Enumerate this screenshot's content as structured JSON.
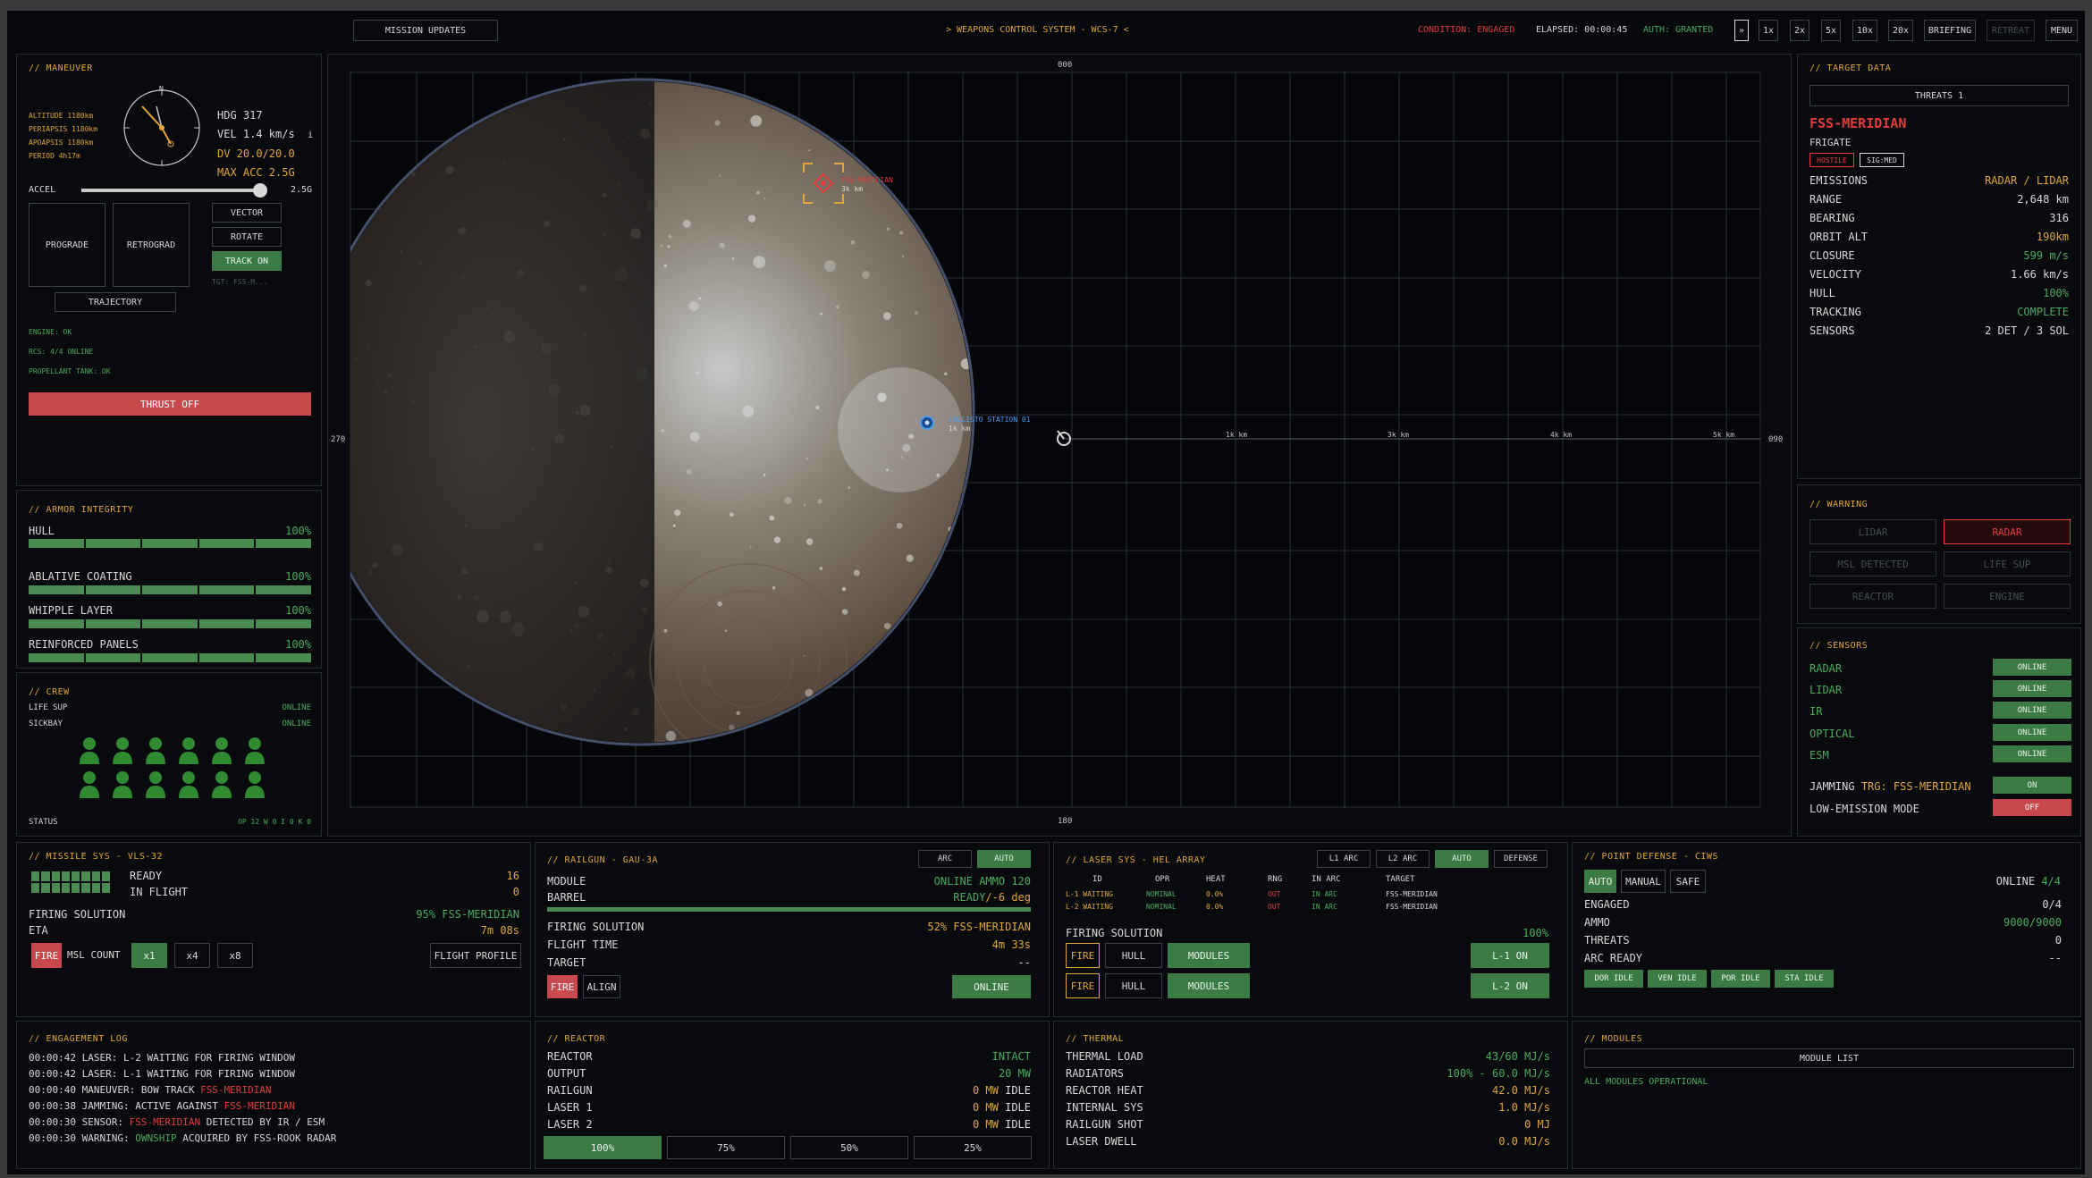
{
  "topbar": {
    "mission_updates": "MISSION UPDATES",
    "title": "> WEAPONS CONTROL SYSTEM - WCS-7 <",
    "condition_label": "CONDITION:",
    "condition_value": "ENGAGED",
    "elapsed": "ELAPSED: 00:00:45",
    "auth": "AUTH: GRANTED",
    "pause": "»",
    "speeds": [
      "1x",
      "2x",
      "5x",
      "10x",
      "20x"
    ],
    "briefing": "BRIEFING",
    "retreat": "RETREAT",
    "menu": "MENU"
  },
  "maneuver": {
    "title": "// MANEUVER",
    "orbit": [
      "ALTITUDE 1180km",
      "PERIAPSIS 1180km",
      "APOAPSIS 1180km",
      "PERIOD 4h17m"
    ],
    "compass_n": "N",
    "hdg": "HDG 317",
    "vel": "VEL 1.4 km/s",
    "vel_unit": "i",
    "dv": "DV 20.0/20.0",
    "max_acc": "MAX ACC 2.5G",
    "accel_label": "ACCEL",
    "accel_value": "2.5G",
    "accel_fraction": 1.0,
    "prograde": "PROGRADE",
    "retrograd": "RETROGRAD",
    "vector": "VECTOR",
    "rotate": "ROTATE",
    "track_on": "TRACK ON",
    "tgt": "TGT: FSS-M...",
    "trajectory": "TRAJECTORY",
    "status": [
      "ENGINE: OK",
      "RCS: 4/4 ONLINE",
      "PROPELLANT TANK: OK"
    ],
    "thrust_off": "THRUST OFF"
  },
  "armor": {
    "title": "// ARMOR INTEGRITY",
    "items": [
      {
        "label": "HULL",
        "value": "100%"
      },
      {
        "label": "ABLATIVE COATING",
        "value": "100%"
      },
      {
        "label": "WHIPPLE LAYER",
        "value": "100%"
      },
      {
        "label": "REINFORCED PANELS",
        "value": "100%"
      }
    ]
  },
  "crew": {
    "title": "// CREW",
    "life_sup_label": "LIFE SUP",
    "life_sup_value": "ONLINE",
    "sickbay_label": "SICKBAY",
    "sickbay_value": "ONLINE",
    "status_label": "STATUS",
    "status_value": "OP 12  W 0  I 0  K 0"
  },
  "map": {
    "top_label": "000",
    "left_label": "270",
    "right_label": "090",
    "bottom_label": "180",
    "ranges": [
      "1k km",
      "3k km",
      "4k km",
      "5k km"
    ],
    "target_name": "FSS MERIDIAN",
    "target_range": "3k km",
    "station_name": "CALLISTO STATION 01",
    "station_range": "1k km"
  },
  "target": {
    "title": "// TARGET DATA",
    "threats": "THREATS 1",
    "name": "FSS-MERIDIAN",
    "class": "FRIGATE",
    "tag_hostile": "HOSTILE",
    "tag_sig": "SIG:MED",
    "rows": [
      {
        "label": "EMISSIONS",
        "value": "RADAR / LIDAR"
      },
      {
        "label": "RANGE",
        "value": "2,648 km"
      },
      {
        "label": "BEARING",
        "value": "316"
      },
      {
        "label": "ORBIT ALT",
        "value": "190km"
      },
      {
        "label": "CLOSURE",
        "value": "599 m/s"
      },
      {
        "label": "VELOCITY",
        "value": "1.66 km/s"
      },
      {
        "label": "HULL",
        "value": "100%"
      },
      {
        "label": "TRACKING",
        "value": "COMPLETE"
      },
      {
        "label": "SENSORS",
        "value": "2 DET / 3 SOL"
      }
    ]
  },
  "warning": {
    "title": "// WARNING",
    "items": [
      "LIDAR",
      "RADAR",
      "MSL DETECTED",
      "LIFE SUP",
      "REACTOR",
      "ENGINE"
    ]
  },
  "sensors": {
    "title": "// SENSORS",
    "items": [
      {
        "label": "RADAR",
        "value": "ONLINE"
      },
      {
        "label": "LIDAR",
        "value": "ONLINE"
      },
      {
        "label": "IR",
        "value": "ONLINE"
      },
      {
        "label": "OPTICAL",
        "value": "ONLINE"
      },
      {
        "label": "ESM",
        "value": "ONLINE"
      }
    ],
    "jamming_label": "JAMMING",
    "jamming_target": "TRG: FSS-MERIDIAN",
    "jamming_value": "ON",
    "lowem_label": "LOW-EMISSION MODE",
    "lowem_value": "OFF"
  },
  "missile": {
    "title": "// MISSILE SYS - VLS-32",
    "ready_label": "READY",
    "ready_value": "16",
    "inflight_label": "IN FLIGHT",
    "inflight_value": "0",
    "fs_label": "FIRING SOLUTION",
    "fs_value": "95% FSS-MERIDIAN",
    "eta_label": "ETA",
    "eta_value": "7m 08s",
    "fire": "FIRE",
    "msl_count": "MSL COUNT",
    "counts": [
      "x1",
      "x4",
      "x8"
    ],
    "flight_profile": "FLIGHT PROFILE"
  },
  "railgun": {
    "title": "// RAILGUN - GAU-3A",
    "arc": "ARC",
    "auto": "AUTO",
    "module_label": "MODULE",
    "module_value": "ONLINE AMMO 120",
    "barrel_label": "BARREL",
    "barrel_ready": "READY",
    "barrel_deg": "/-6 deg",
    "fs_label": "FIRING SOLUTION",
    "fs_value": "52% FSS-MERIDIAN",
    "ft_label": "FLIGHT TIME",
    "ft_value": "4m 33s",
    "target_label": "TARGET",
    "target_value": "--",
    "fire": "FIRE",
    "align": "ALIGN",
    "online": "ONLINE"
  },
  "laser": {
    "title": "// LASER SYS - HEL ARRAY",
    "l1arc": "L1 ARC",
    "l2arc": "L2 ARC",
    "auto": "AUTO",
    "defense": "DEFENSE",
    "headers": [
      "ID",
      "OPR",
      "HEAT",
      "RNG",
      "IN ARC",
      "TARGET"
    ],
    "rows": [
      [
        "L-1 WAITING",
        "NOMINAL",
        "0.0%",
        "OUT",
        "IN ARC",
        "FSS-MERIDIAN"
      ],
      [
        "L-2 WAITING",
        "NOMINAL",
        "0.0%",
        "OUT",
        "IN ARC",
        "FSS-MERIDIAN"
      ]
    ],
    "fs_label": "FIRING SOLUTION",
    "fs_value": "100%",
    "fire": "FIRE",
    "hull": "HULL",
    "modules": "MODULES",
    "l1on": "L-1 ON",
    "l2on": "L-2 ON"
  },
  "pd": {
    "title": "// POINT DEFENSE - CIWS",
    "auto": "AUTO",
    "manual": "MANUAL",
    "safe": "SAFE",
    "online_label": "ONLINE",
    "online_value": "4/4",
    "rows": [
      {
        "label": "ENGAGED",
        "value": "0/4"
      },
      {
        "label": "AMMO",
        "value": "9000/9000"
      },
      {
        "label": "THREATS",
        "value": "0"
      },
      {
        "label": "ARC READY",
        "value": "--"
      }
    ],
    "idle": [
      "DOR IDLE",
      "VEN IDLE",
      "POR IDLE",
      "STA IDLE"
    ]
  },
  "log": {
    "title": "// ENGAGEMENT LOG",
    "entries": [
      {
        "t": "00:00:42",
        "a": "LASER: L-2 WAITING FOR FIRING WINDOW",
        "h": "",
        "b": ""
      },
      {
        "t": "00:00:42",
        "a": "LASER: L-1 WAITING FOR FIRING WINDOW",
        "h": "",
        "b": ""
      },
      {
        "t": "00:00:40",
        "a": "MANEUVER: BOW TRACK ",
        "h": "FSS-MERIDIAN",
        "b": ""
      },
      {
        "t": "00:00:38",
        "a": "JAMMING: ACTIVE AGAINST ",
        "h": "FSS-MERIDIAN",
        "b": ""
      },
      {
        "t": "00:00:30",
        "a": "SENSOR: ",
        "h": "FSS-MERIDIAN",
        "b": " DETECTED BY IR / ESM"
      },
      {
        "t": "00:00:30",
        "a": "WARNING: ",
        "h": "OWNSHIP",
        "b": " ACQUIRED BY FSS-ROOK RADAR"
      }
    ]
  },
  "reactor": {
    "title": "// REACTOR",
    "rows": [
      {
        "label": "REACTOR",
        "value": "INTACT",
        "suffix": ""
      },
      {
        "label": "OUTPUT",
        "value": "20 MW",
        "suffix": ""
      },
      {
        "label": "RAILGUN",
        "value": "0 MW",
        "suffix": " IDLE"
      },
      {
        "label": "LASER 1",
        "value": "0 MW",
        "suffix": " IDLE"
      },
      {
        "label": "LASER 2",
        "value": "0 MW",
        "suffix": " IDLE"
      }
    ],
    "levels": [
      "100%",
      "75%",
      "50%",
      "25%"
    ]
  },
  "thermal": {
    "title": "// THERMAL",
    "rows": [
      {
        "label": "THERMAL LOAD",
        "value": "43/60 MJ/s"
      },
      {
        "label": "RADIATORS",
        "value": "100% - 60.0 MJ/s"
      },
      {
        "label": "REACTOR HEAT",
        "value": "42.0 MJ/s"
      },
      {
        "label": "INTERNAL SYS",
        "value": "1.0 MJ/s"
      },
      {
        "label": "RAILGUN SHOT",
        "value": "0 MJ"
      },
      {
        "label": "LASER DWELL",
        "value": "0.0 MJ/s"
      }
    ]
  },
  "modules": {
    "title": "// MODULES",
    "list": "MODULE LIST",
    "status": "ALL MODULES OPERATIONAL"
  }
}
